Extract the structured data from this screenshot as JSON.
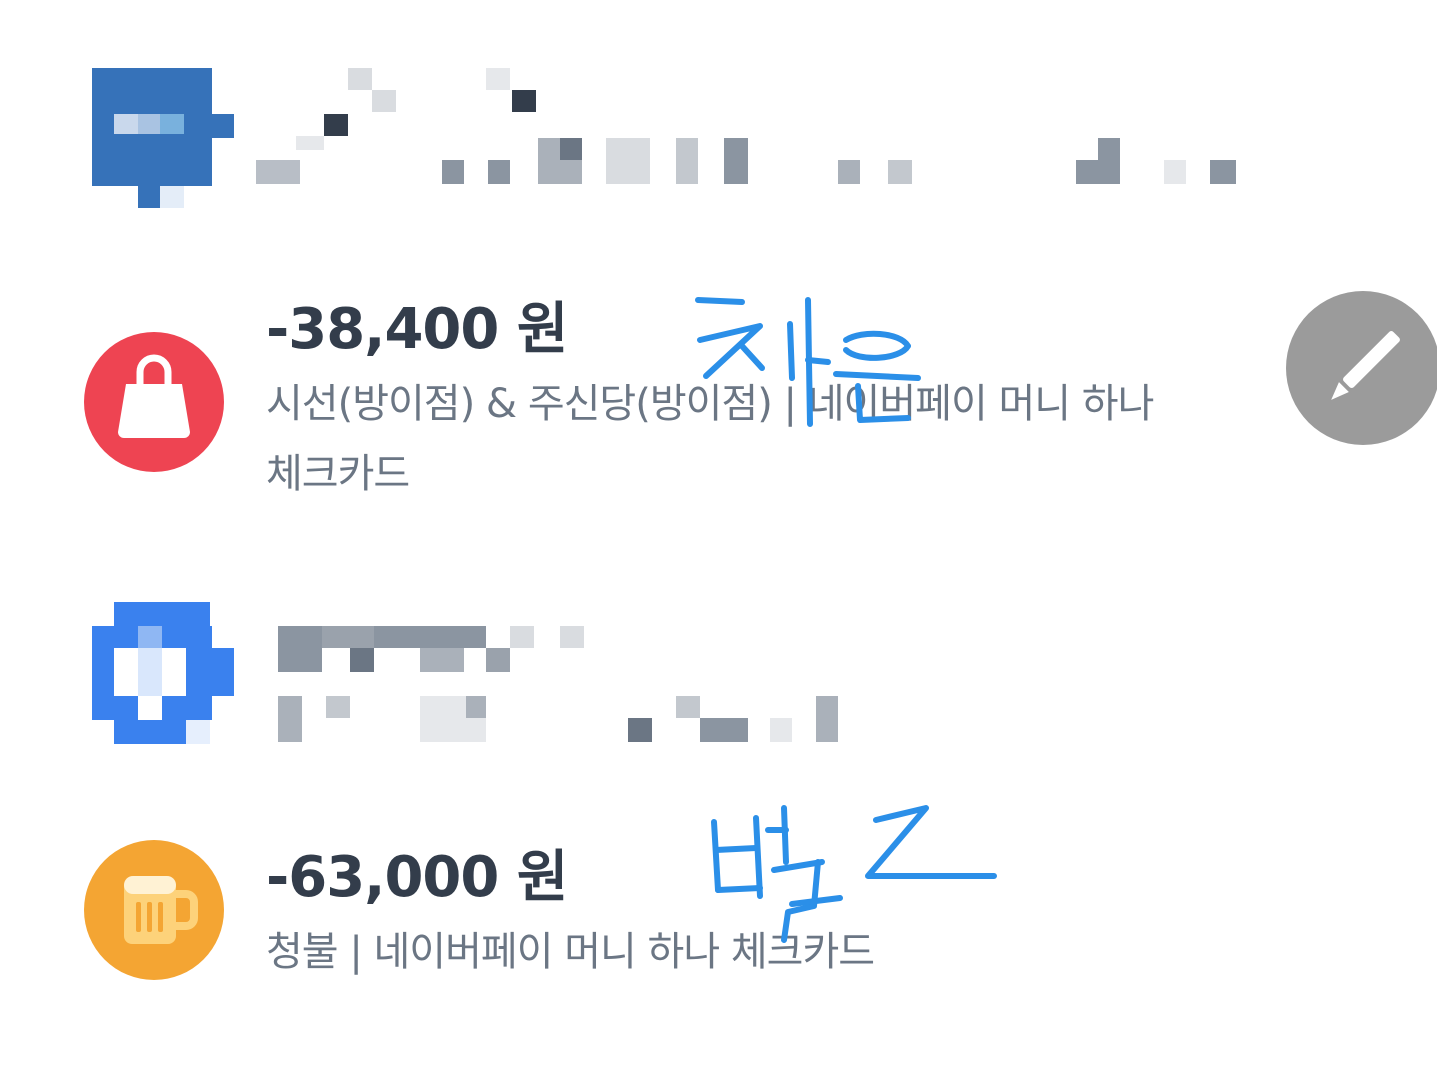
{
  "transactions": [
    {
      "amount": "-38,400 원",
      "description_line1": "시선(방이점) & 주신당(방이점) | 네이버페이 머니 하나",
      "description_line2": "체크카드",
      "icon": "shopping-bag-icon",
      "icon_color": "#ee4452"
    },
    {
      "amount": "-63,000 원",
      "description_line1": "청불 | 네이버페이 머니 하나 체크카드",
      "icon": "beer-mug-icon",
      "icon_color": "#f4a533"
    }
  ],
  "annotations": {
    "handwritten_note_1": "차음",
    "handwritten_note_2": "별로",
    "ink_color": "#2b8fe8"
  },
  "edit_button": {
    "icon": "pencil-icon",
    "color": "#9b9b9b"
  }
}
